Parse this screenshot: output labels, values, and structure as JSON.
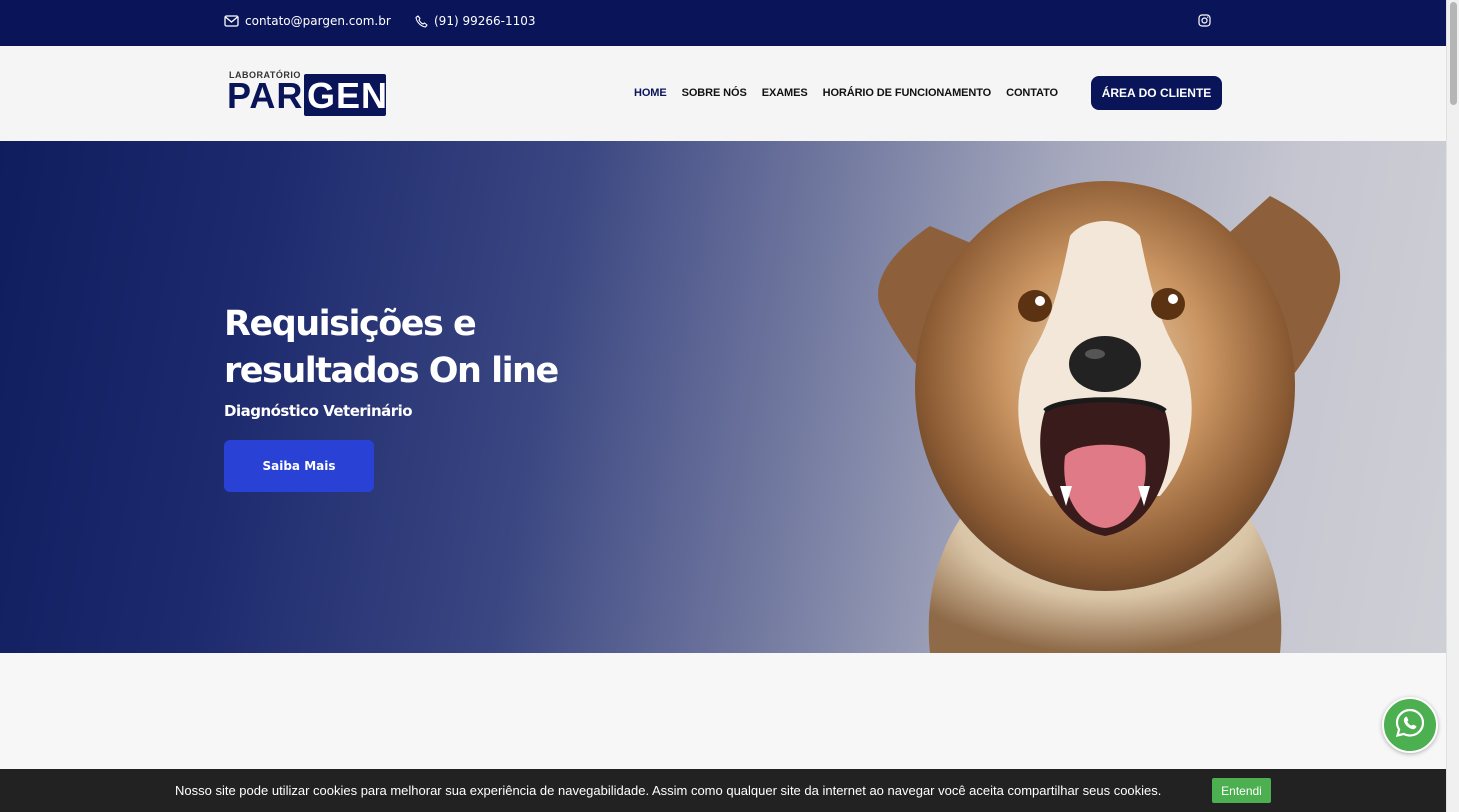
{
  "topbar": {
    "email": "contato@pargen.com.br",
    "phone": "(91) 99266-1103",
    "email_icon": "mail-icon",
    "phone_icon": "phone-icon",
    "social_icon": "instagram-icon"
  },
  "logo": {
    "small": "LABORATÓRIO",
    "par": "PAR",
    "gen": "GEN"
  },
  "nav": {
    "items": [
      {
        "label": "HOME"
      },
      {
        "label": "SOBRE NÓS"
      },
      {
        "label": "EXAMES"
      },
      {
        "label": "HORÁRIO DE FUNCIONAMENTO"
      },
      {
        "label": "CONTATO"
      }
    ],
    "cta": "ÁREA DO CLIENTE"
  },
  "hero": {
    "title": "Requisições e resultados On line",
    "subtitle": "Diagnóstico Veterinário",
    "button": "Saiba Mais"
  },
  "whatsapp": {
    "icon": "whatsapp-icon"
  },
  "cookie": {
    "text": "Nosso site pode utilizar cookies para melhorar sua experiência de navegabilidade. Assim como qualquer site da internet ao navegar você aceita compartilhar seus cookies.",
    "button": "Entendi"
  },
  "colors": {
    "brand_navy": "#0a1459",
    "button_blue": "#2a41d6",
    "cookie_green": "#4caf50"
  }
}
